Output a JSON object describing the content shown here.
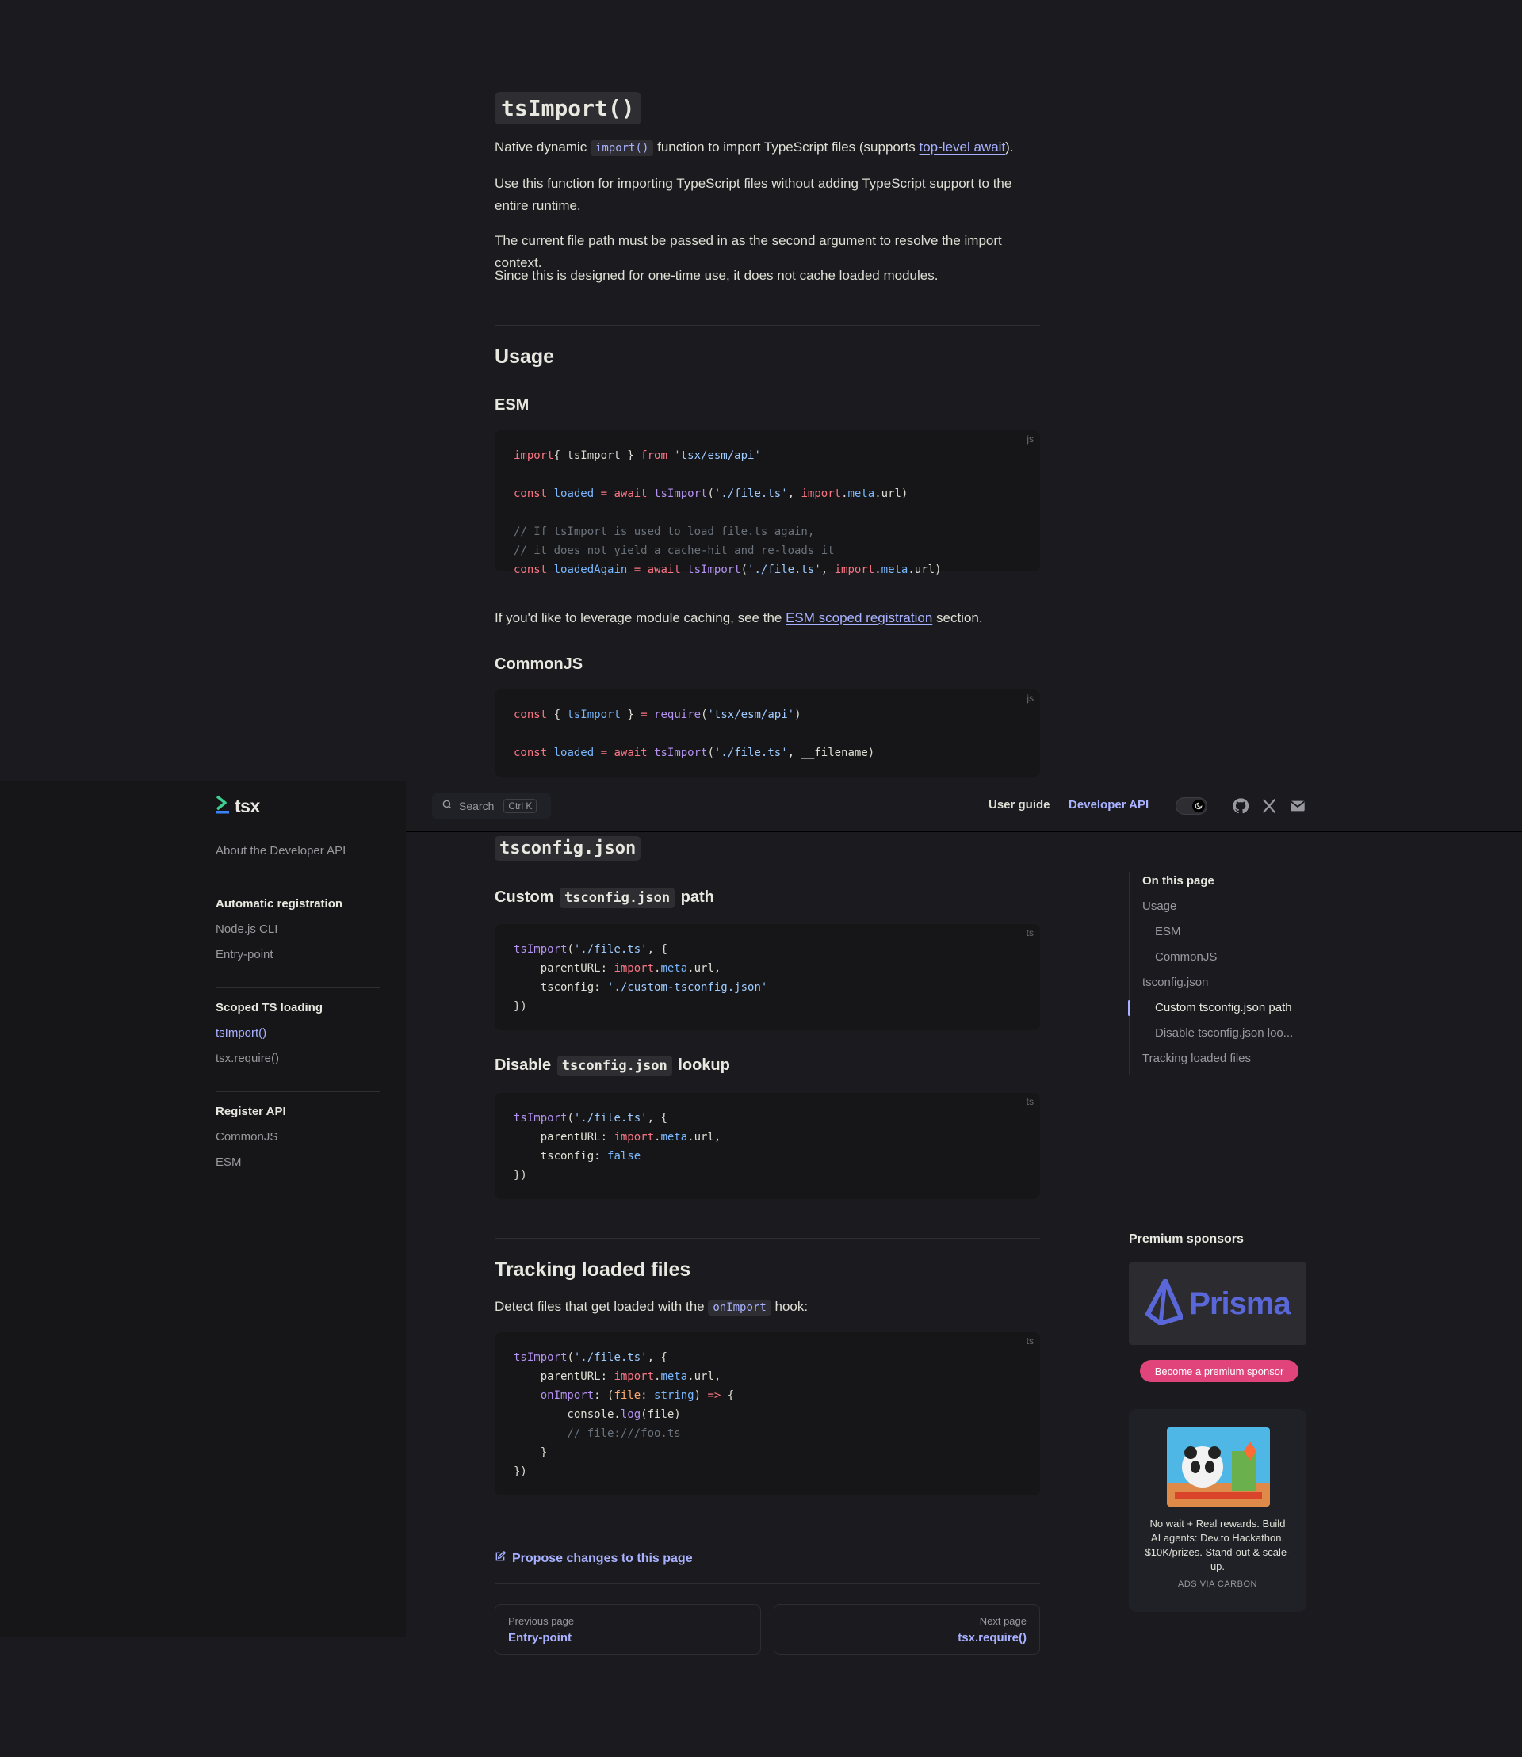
{
  "header": {
    "logo_text": "tsx",
    "search_label": "Search",
    "search_shortcut": "Ctrl K",
    "nav": [
      "User guide",
      "Developer API"
    ],
    "active_nav": "Developer API"
  },
  "sidebar": {
    "about": "About the Developer API",
    "groups": [
      {
        "title": "Automatic registration",
        "items": [
          "Node.js CLI",
          "Entry-point"
        ]
      },
      {
        "title": "Scoped TS loading",
        "items": [
          "tsImport()",
          "tsx.require()"
        ],
        "active": "tsImport()"
      },
      {
        "title": "Register API",
        "items": [
          "CommonJS",
          "ESM"
        ]
      }
    ]
  },
  "main": {
    "title": "tsImport()",
    "intro": {
      "p1_before": "Native dynamic ",
      "p1_code": "import()",
      "p1_middle": " function to import TypeScript files (supports ",
      "p1_link": "top-level await",
      "p1_after": ").",
      "p2": "Use this function for importing TypeScript files without adding TypeScript support to the entire runtime.",
      "p3": "The current file path must be passed in as the second argument to resolve the import context.",
      "p4": "Since this is designed for one-time use, it does not cache loaded modules."
    },
    "usage_heading": "Usage",
    "esm_heading": "ESM",
    "esm_lang": "js",
    "caching_note": {
      "before": "If you'd like to leverage module caching, see the ",
      "link": "ESM scoped registration",
      "after": " section."
    },
    "cjs_heading": "CommonJS",
    "cjs_lang": "js",
    "tsconfig_heading": "tsconfig.json",
    "custom_heading": {
      "before": "Custom ",
      "code": "tsconfig.json",
      "after": " path"
    },
    "custom_lang": "ts",
    "disable_heading": {
      "before": "Disable ",
      "code": "tsconfig.json",
      "after": " lookup"
    },
    "disable_lang": "ts",
    "tracking_heading": "Tracking loaded files",
    "tracking_note": {
      "before": "Detect files that get loaded with the ",
      "code": "onImport",
      "after": " hook:"
    },
    "tracking_lang": "ts"
  },
  "code": {
    "esm": [
      [
        [
          "kw",
          "import"
        ],
        [
          "",
          "{ tsImport } "
        ],
        [
          "kw",
          "from"
        ],
        [
          "str",
          " 'tsx/esm/api'"
        ]
      ],
      [],
      [
        [
          "kw",
          "const"
        ],
        [
          "var",
          " loaded"
        ],
        [
          "kw",
          " ="
        ],
        [
          "kw",
          " await"
        ],
        [
          "fn",
          " tsImport"
        ],
        [
          "",
          "("
        ],
        [
          "str",
          "'./file.ts'"
        ],
        [
          "",
          ", "
        ],
        [
          "kw",
          "import"
        ],
        [
          "",
          ".",
          ""
        ],
        [
          "var",
          "meta"
        ],
        [
          "",
          ".url)"
        ]
      ],
      [],
      [
        [
          "cm",
          "// If tsImport is used to load file.ts again,"
        ]
      ],
      [
        [
          "cm",
          "// it does not yield a cache-hit and re-loads it"
        ]
      ],
      [
        [
          "kw",
          "const"
        ],
        [
          "var",
          " loadedAgain"
        ],
        [
          "kw",
          " ="
        ],
        [
          "kw",
          " await"
        ],
        [
          "fn",
          " tsImport"
        ],
        [
          "",
          "("
        ],
        [
          "str",
          "'./file.ts'"
        ],
        [
          "",
          ", "
        ],
        [
          "kw",
          "import"
        ],
        [
          "",
          "."
        ],
        [
          "var",
          "meta"
        ],
        [
          "",
          ".url)"
        ]
      ]
    ],
    "cjs": [
      [
        [
          "kw",
          "const"
        ],
        [
          "",
          " { "
        ],
        [
          "var",
          "tsImport"
        ],
        [
          "",
          " } "
        ],
        [
          "kw",
          "="
        ],
        [
          "fn",
          " require"
        ],
        [
          "",
          "("
        ],
        [
          "str",
          "'tsx/esm/api'"
        ],
        [
          "",
          ")"
        ]
      ],
      [],
      [
        [
          "kw",
          "const"
        ],
        [
          "var",
          " loaded"
        ],
        [
          "kw",
          " ="
        ],
        [
          "kw",
          " await"
        ],
        [
          "fn",
          " tsImport"
        ],
        [
          "",
          "("
        ],
        [
          "str",
          "'./file.ts'"
        ],
        [
          "",
          ", __filename)"
        ]
      ]
    ],
    "custom": [
      [
        [
          "fn",
          "tsImport"
        ],
        [
          "",
          "("
        ],
        [
          "str",
          "'./file.ts'"
        ],
        [
          "",
          ", {"
        ]
      ],
      [
        [
          "",
          "    parentURL: "
        ],
        [
          "kw",
          "import"
        ],
        [
          "",
          "."
        ],
        [
          "var",
          "meta"
        ],
        [
          "",
          ".url,"
        ]
      ],
      [
        [
          "",
          "    tsconfig: "
        ],
        [
          "str",
          "'./custom-tsconfig.json'"
        ]
      ],
      [
        [
          "",
          "})"
        ]
      ]
    ],
    "disable": [
      [
        [
          "fn",
          "tsImport"
        ],
        [
          "",
          "("
        ],
        [
          "str",
          "'./file.ts'"
        ],
        [
          "",
          ", {"
        ]
      ],
      [
        [
          "",
          "    parentURL: "
        ],
        [
          "kw",
          "import"
        ],
        [
          "",
          "."
        ],
        [
          "var",
          "meta"
        ],
        [
          "",
          ".url,"
        ]
      ],
      [
        [
          "",
          "    tsconfig: "
        ],
        [
          "var",
          "false"
        ]
      ],
      [
        [
          "",
          "})"
        ]
      ]
    ],
    "tracking": [
      [
        [
          "fn",
          "tsImport"
        ],
        [
          "",
          "("
        ],
        [
          "str",
          "'./file.ts'"
        ],
        [
          "",
          ", {"
        ]
      ],
      [
        [
          "",
          "    parentURL: "
        ],
        [
          "kw",
          "import"
        ],
        [
          "",
          "."
        ],
        [
          "var",
          "meta"
        ],
        [
          "",
          ".url,"
        ]
      ],
      [
        [
          "fn",
          "    onImport"
        ],
        [
          "",
          ": ("
        ],
        [
          "prm",
          "file"
        ],
        [
          "",
          ": "
        ],
        [
          "tp",
          "string"
        ],
        [
          "",
          ") "
        ],
        [
          "kw",
          "=>"
        ],
        [
          "",
          " {"
        ]
      ],
      [
        [
          "",
          "        console."
        ],
        [
          "fn",
          "log"
        ],
        [
          "",
          "(file)"
        ]
      ],
      [
        [
          "cm",
          "        // file:///foo.ts"
        ]
      ],
      [
        [
          "",
          "    }"
        ]
      ],
      [
        [
          "",
          "})"
        ]
      ]
    ]
  },
  "toc": {
    "title": "On this page",
    "items": [
      {
        "label": "Usage",
        "level": 1
      },
      {
        "label": "ESM",
        "level": 2
      },
      {
        "label": "CommonJS",
        "level": 2
      },
      {
        "label": "tsconfig.json",
        "level": 1
      },
      {
        "label": "Custom tsconfig.json path",
        "level": 2,
        "active": true
      },
      {
        "label": "Disable tsconfig.json loo...",
        "level": 2
      },
      {
        "label": "Tracking loaded files",
        "level": 1
      }
    ]
  },
  "sponsors": {
    "title": "Premium sponsors",
    "prisma_text": "Prisma",
    "button": "Become a premium sponsor",
    "ad_text": "No wait + Real rewards. Build AI agents: Dev.to Hackathon. $10K/prizes. Stand-out & scale-up.",
    "ad_via": "ADS VIA CARBON"
  },
  "footer": {
    "edit_link": "Propose changes to this page",
    "prev_desc": "Previous page",
    "prev_title": "Entry-point",
    "next_desc": "Next page",
    "next_title": "tsx.require()"
  },
  "colors": {
    "background": "#1b1b1f",
    "sidebar": "#161618",
    "accent": "#a8b1ff",
    "sponsor_button": "#e0447b"
  }
}
